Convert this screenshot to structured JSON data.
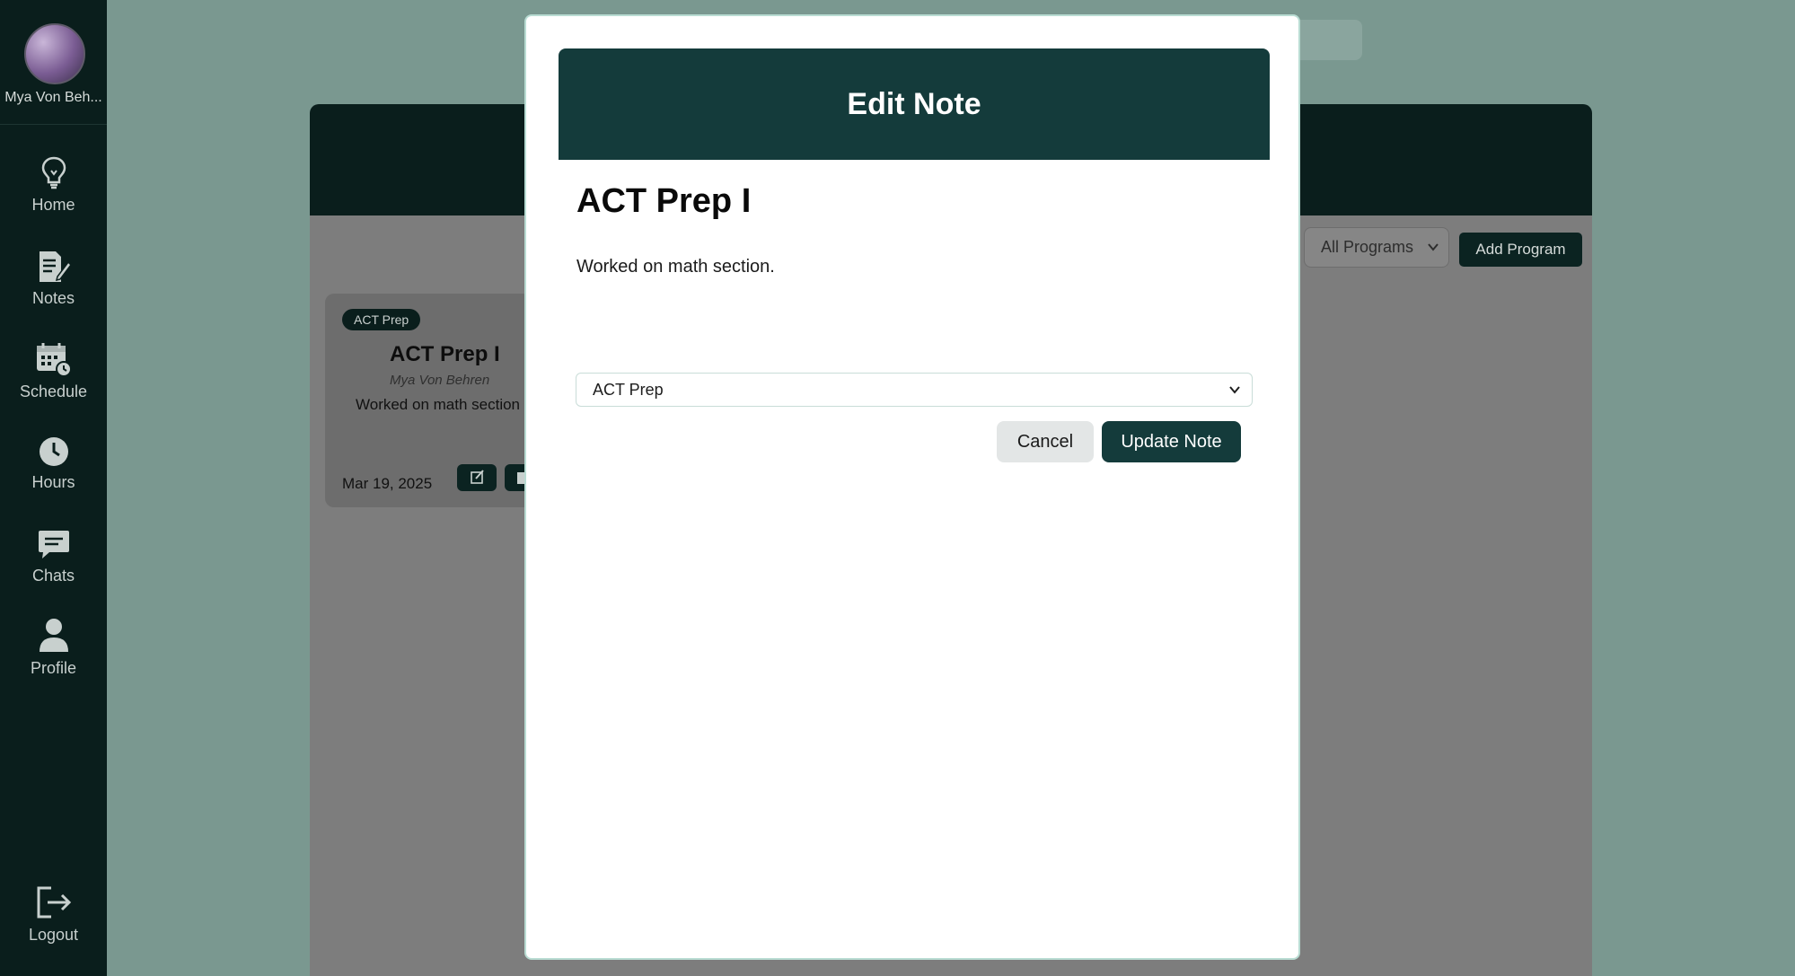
{
  "sidebar": {
    "user_name": "Mya Von Beh...",
    "items": [
      {
        "label": "Home",
        "icon": "lightbulb-icon"
      },
      {
        "label": "Notes",
        "icon": "notes-icon"
      },
      {
        "label": "Schedule",
        "icon": "calendar-icon"
      },
      {
        "label": "Hours",
        "icon": "clock-icon"
      },
      {
        "label": "Chats",
        "icon": "chat-icon"
      },
      {
        "label": "Profile",
        "icon": "user-icon"
      }
    ],
    "logout_label": "Logout"
  },
  "background": {
    "filter": {
      "selected": "All Programs"
    },
    "add_program_label": "Add Program",
    "note_card": {
      "tag": "ACT Prep",
      "title": "ACT Prep I",
      "author": "Mya Von Behren",
      "text": "Worked on math section",
      "date": "Mar 19, 2025"
    }
  },
  "modal": {
    "header": "Edit Note",
    "note_title": "ACT Prep I",
    "note_body": "Worked on math section.",
    "program_selected": "ACT Prep",
    "cancel_label": "Cancel",
    "update_label": "Update Note"
  },
  "colors": {
    "sidebar_bg": "#0a1e1c",
    "primary": "#143b3b",
    "modal_bg": "#ffffff"
  }
}
